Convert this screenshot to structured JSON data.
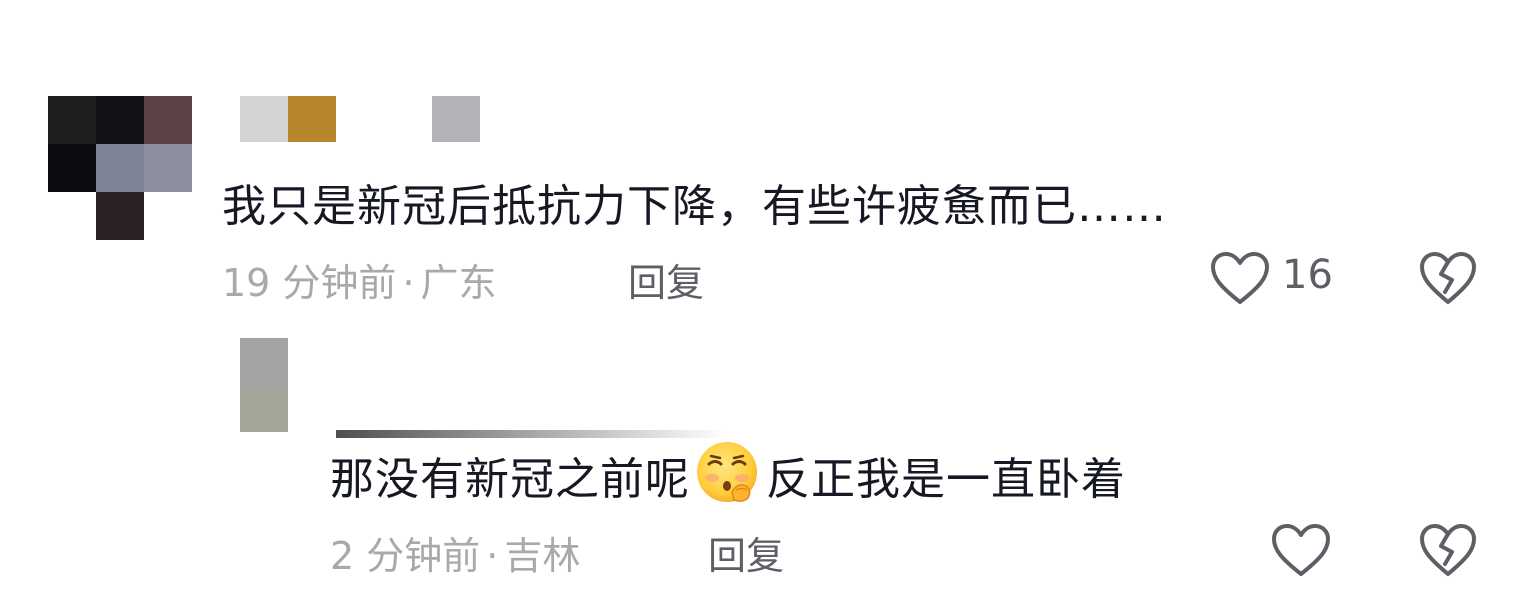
{
  "comments": [
    {
      "text": "我只是新冠后抵抗力下降，有些许疲惫而已……",
      "time": "19 分钟前",
      "separator": "·",
      "location": "广东",
      "reply_label": "回复",
      "like_count": "16"
    }
  ],
  "replies": [
    {
      "text_before": "那没有新冠之前呢",
      "text_after": "反正我是一直卧着",
      "emoji_name": "shushing-face-emoji",
      "time": "2 分钟前",
      "separator": "·",
      "location": "吉林",
      "reply_label": "回复"
    }
  ],
  "colors": {
    "text_primary": "#161823",
    "text_meta": "#a9a9ad",
    "reply_text": "#5e5f66",
    "icon": "#5e5f66"
  },
  "icons": [
    "heart-outline-icon",
    "broken-heart-icon"
  ]
}
